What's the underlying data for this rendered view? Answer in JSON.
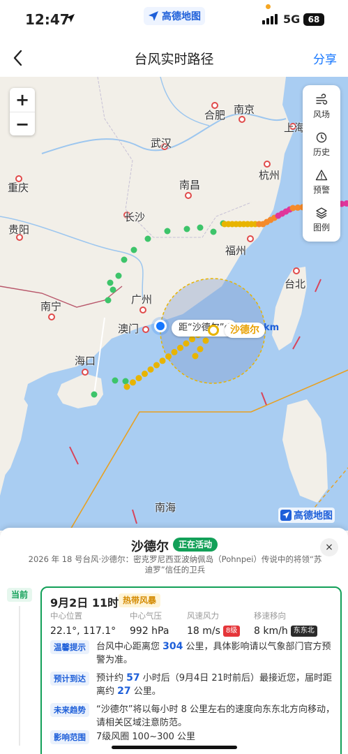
{
  "status_bar": {
    "time": "12:47",
    "app_name": "高德地图",
    "network": "5G",
    "battery": "68"
  },
  "nav": {
    "title": "台风实时路径",
    "share_label": "分享"
  },
  "map": {
    "zoom_in_label": "+",
    "zoom_out_label": "−",
    "tools": [
      {
        "label": "风场",
        "icon": "wind-icon"
      },
      {
        "label": "历史",
        "icon": "history-icon"
      },
      {
        "label": "预警",
        "icon": "warning-icon"
      },
      {
        "label": "图例",
        "icon": "layers-icon"
      }
    ],
    "cities": [
      "合肥",
      "南京",
      "上海",
      "武汉",
      "杭州",
      "重庆",
      "南昌",
      "长沙",
      "贵阳",
      "福州",
      "台北",
      "广州",
      "南宁",
      "澳门",
      "海口",
      "南海"
    ],
    "distance_callout": "距“沙德尔”d",
    "distance_unit": "km",
    "storm_label": "沙德尔",
    "map_logo": "高德地图",
    "colors": {
      "land": "#f2efe8",
      "sea": "#a9cdf2",
      "track_green": "#3dc46a",
      "track_yellow": "#e8b400",
      "track_orange": "#f58a2a",
      "track_magenta": "#e0359b"
    }
  },
  "sheet": {
    "name": "沙德尔",
    "status": "正在活动",
    "description": "2026 年 18 号台风·沙德尔：密克罗尼西亚波纳佩岛（Pohnpei）传说中的将领“苏迪罗”信任的卫兵",
    "close_label": "×",
    "timeline_label": "当前",
    "card": {
      "datetime": "9月2日 11时",
      "level": "热带风暴",
      "metrics": [
        {
          "label": "中心位置",
          "value": "22.1°, 117.1°"
        },
        {
          "label": "中心气压",
          "value": "992 hPa"
        },
        {
          "label": "风速风力",
          "value": "18 m/s",
          "badge": "8级"
        },
        {
          "label": "移速移向",
          "value": "8 km/h",
          "badge": "东东北"
        }
      ],
      "rows": [
        {
          "tag": "温馨提示",
          "pre": "台风中心距离您 ",
          "num": "304",
          "post": " 公里，具体影响请以气象部门官方预警为准。"
        },
        {
          "tag": "预计到达",
          "pre": "预计约 ",
          "num": "57",
          "post": " 小时后（9月4日 21时前后）最接近您，届时距离约 ",
          "num2": "27",
          "post2": " 公里。"
        },
        {
          "tag": "未来趋势",
          "pre": "“沙德尔”将以每小时 8 公里左右的速度向东东北方向移动，请相关区域注意防范。"
        },
        {
          "tag": "影响范围",
          "pre": "7级风圈 100~300 公里"
        }
      ]
    }
  }
}
